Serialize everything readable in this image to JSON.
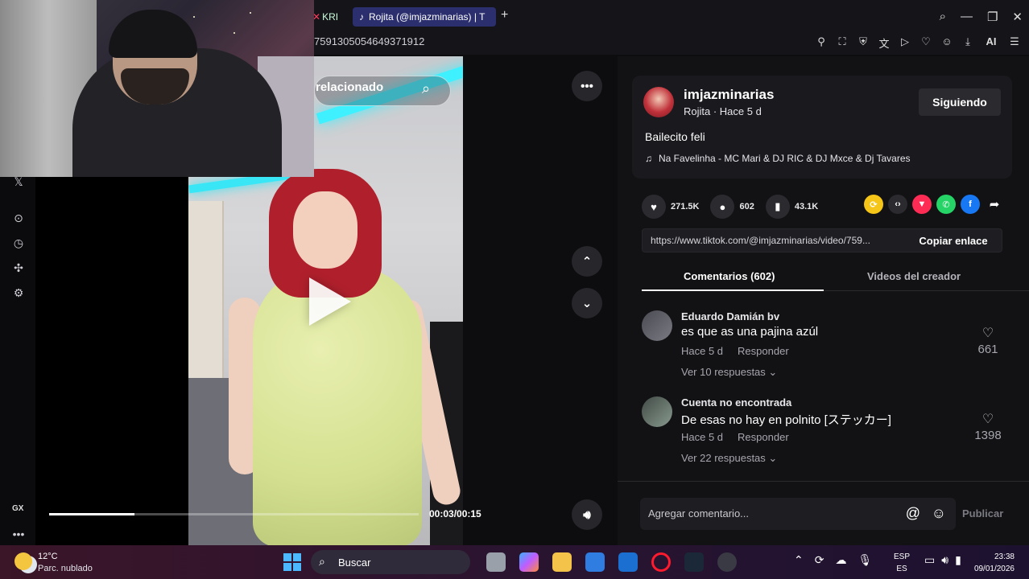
{
  "browser": {
    "partial_tab_label": "KRI",
    "active_tab_label": "Rojita (@imjazminarias) | T",
    "url_fragment": "7591305054649371912",
    "toolbar_ai_label": "AI"
  },
  "sidebar": {
    "gx_label": "GX",
    "more_label": "•••"
  },
  "video": {
    "related_label": "relacionado",
    "current_time": "00:03",
    "duration": "00:15",
    "time_display": "00:03/00:15",
    "progress_fraction": 0.23,
    "more_label": "•••"
  },
  "post": {
    "username": "imjazminarias",
    "display_name": "Rojita",
    "time_ago": "Hace 5 d",
    "subline": "Rojita · Hace 5 d",
    "follow_label": "Siguiendo",
    "description": "Bailecito feli",
    "music": "Na Favelinha - MC Mari & DJ RIC & DJ Mxce & Dj Tavares",
    "likes": "271.5K",
    "comments": "602",
    "saves": "43.1K",
    "link_url": "https://www.tiktok.com/@imjazminarias/video/759...",
    "copy_link_label": "Copiar enlace"
  },
  "tabs": {
    "comments_label": "Comentarios (602)",
    "creator_videos_label": "Videos del creador"
  },
  "comments": [
    {
      "author": "Eduardo Damián bv",
      "text": "es que as una pajina azúl",
      "time": "Hace 5 d",
      "reply_label": "Responder",
      "replies_label": "Ver 10 respuestas",
      "likes": "661"
    },
    {
      "author": "Cuenta no encontrada",
      "text": "De esas no hay en polnito [ステッカー]",
      "time": "Hace 5 d",
      "reply_label": "Responder",
      "replies_label": "Ver 22 respuestas",
      "likes": "1398"
    }
  ],
  "comment_bar": {
    "placeholder": "Agregar comentario...",
    "publish_label": "Publicar"
  },
  "taskbar": {
    "temperature": "12°C",
    "condition": "Parc. nublado",
    "search_label": "Buscar",
    "lang_top": "ESP",
    "lang_bottom": "ES",
    "time": "23:38",
    "date": "09/01/2026"
  },
  "colors": {
    "accent_tab": "#2b2f6e",
    "panel_bg": "#121214",
    "opera_red": "#ff1b2d"
  }
}
